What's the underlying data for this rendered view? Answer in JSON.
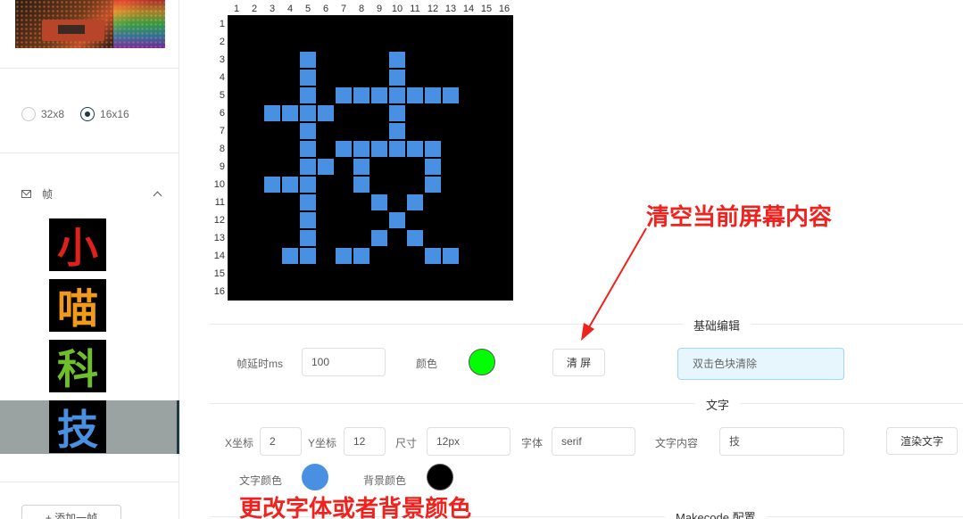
{
  "sidebar": {
    "resolution_options": [
      {
        "label": "32x8",
        "selected": false
      },
      {
        "label": "16x16",
        "selected": true
      }
    ],
    "frames_title": "帧",
    "frames": [
      {
        "char": "小",
        "color": "#e0201c"
      },
      {
        "char": "喵",
        "color": "#f09a1c"
      },
      {
        "char": "科",
        "color": "#6fbf2a"
      },
      {
        "char": "技",
        "color": "#4a90e2"
      }
    ],
    "add_frame_label": "+ 添加一帧"
  },
  "matrix": {
    "cols": 16,
    "rows": 16,
    "col_labels": [
      "1",
      "2",
      "3",
      "4",
      "5",
      "6",
      "7",
      "8",
      "9",
      "10",
      "11",
      "12",
      "13",
      "14",
      "15",
      "16"
    ],
    "row_labels": [
      "1",
      "2",
      "3",
      "4",
      "5",
      "6",
      "7",
      "8",
      "9",
      "10",
      "11",
      "12",
      "13",
      "14",
      "15",
      "16"
    ],
    "on_color": "#4a90e2",
    "off_color": "#000000",
    "lit_cells": [
      [
        5,
        3
      ],
      [
        10,
        3
      ],
      [
        5,
        4
      ],
      [
        10,
        4
      ],
      [
        5,
        5
      ],
      [
        7,
        5
      ],
      [
        8,
        5
      ],
      [
        9,
        5
      ],
      [
        10,
        5
      ],
      [
        11,
        5
      ],
      [
        12,
        5
      ],
      [
        13,
        5
      ],
      [
        3,
        6
      ],
      [
        4,
        6
      ],
      [
        5,
        6
      ],
      [
        6,
        6
      ],
      [
        10,
        6
      ],
      [
        5,
        7
      ],
      [
        10,
        7
      ],
      [
        5,
        8
      ],
      [
        7,
        8
      ],
      [
        8,
        8
      ],
      [
        9,
        8
      ],
      [
        10,
        8
      ],
      [
        11,
        8
      ],
      [
        12,
        8
      ],
      [
        5,
        9
      ],
      [
        6,
        9
      ],
      [
        8,
        9
      ],
      [
        12,
        9
      ],
      [
        3,
        10
      ],
      [
        4,
        10
      ],
      [
        5,
        10
      ],
      [
        8,
        10
      ],
      [
        12,
        10
      ],
      [
        5,
        11
      ],
      [
        9,
        11
      ],
      [
        11,
        11
      ],
      [
        5,
        12
      ],
      [
        10,
        12
      ],
      [
        5,
        13
      ],
      [
        9,
        13
      ],
      [
        11,
        13
      ],
      [
        4,
        14
      ],
      [
        5,
        14
      ],
      [
        7,
        14
      ],
      [
        8,
        14
      ],
      [
        12,
        14
      ],
      [
        13,
        14
      ]
    ]
  },
  "basic_edit": {
    "section_title": "基础编辑",
    "delay_label": "帧延时ms",
    "delay_value": "100",
    "color_label": "颜色",
    "color_value": "#00ff00",
    "clear_button": "清 屏",
    "tip": "双击色块清除"
  },
  "text_section": {
    "section_title": "文字",
    "x_label": "X坐标",
    "x_value": "2",
    "y_label": "Y坐标",
    "y_value": "12",
    "size_label": "尺寸",
    "size_value": "12px",
    "font_label": "字体",
    "font_value": "serif",
    "content_label": "文字内容",
    "content_value": "技",
    "render_button": "渲染文字",
    "text_color_label": "文字颜色",
    "text_color": "#4a90e2",
    "bg_color_label": "背景颜色",
    "bg_color": "#000000"
  },
  "makecode": {
    "section_title": "Makecode 配置"
  },
  "annotations": {
    "clear_note": "清空当前屏幕内容",
    "font_note": "更改字体或者背景颜色"
  }
}
